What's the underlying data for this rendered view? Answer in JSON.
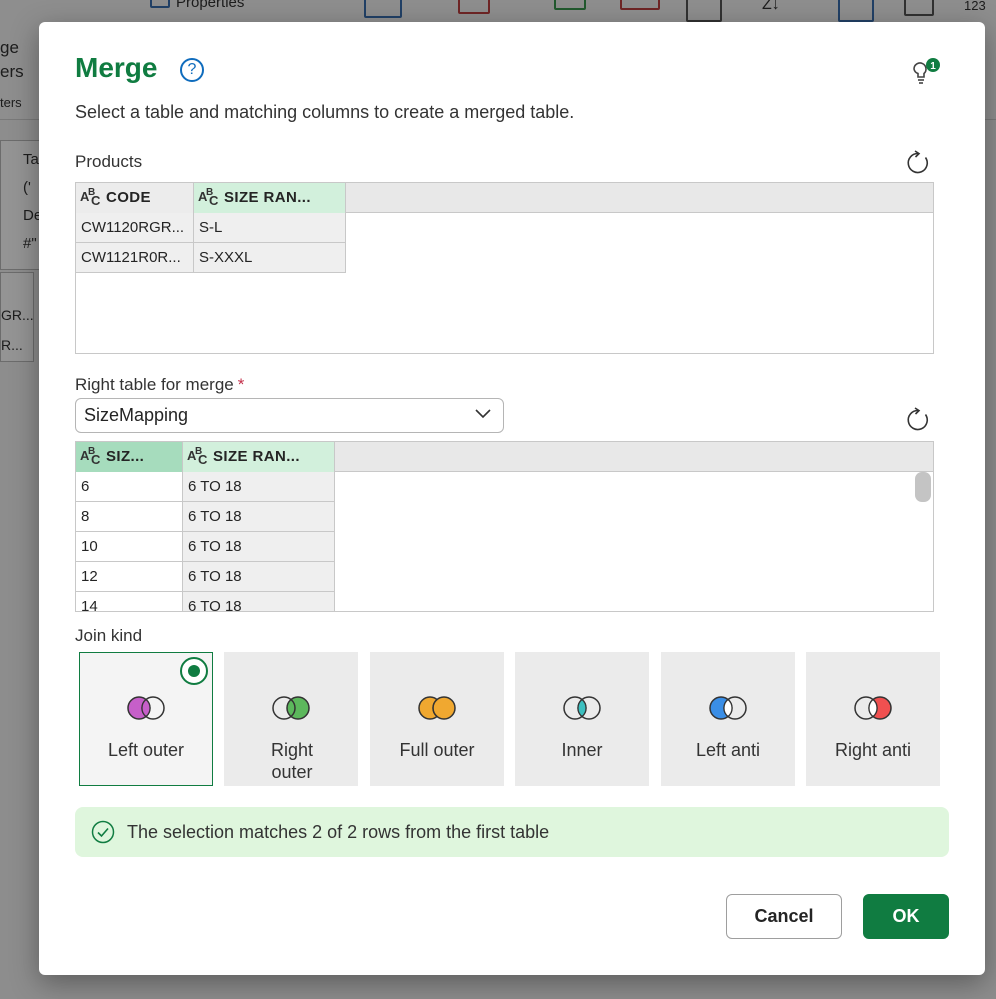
{
  "background": {
    "ribbon_properties": "Properties",
    "ribbon_merge_partial": "ge",
    "ribbon_headers_partial": "ers",
    "ribbon_parameters_partial": "ters",
    "ribbon_sort_partial": "Z↓",
    "ribbon_123": "123",
    "formula_lines": [
      "Ta",
      "('",
      "De",
      "#\""
    ],
    "grid_cells": [
      "GR...",
      "R..."
    ]
  },
  "dialog": {
    "title": "Merge",
    "help_symbol": "?",
    "notification_count": "1",
    "subtitle": "Select a table and matching columns to create a merged table."
  },
  "first_table": {
    "name": "Products",
    "columns": [
      "CODE",
      "SIZE RAN..."
    ],
    "rows": [
      [
        "CW1120RGR...",
        "S-L"
      ],
      [
        "CW1121R0R...",
        "S-XXXL"
      ]
    ]
  },
  "right_table": {
    "label": "Right table for merge",
    "required_mark": "*",
    "selected": "SizeMapping",
    "columns": [
      "SIZ...",
      "SIZE RAN..."
    ],
    "rows": [
      [
        "6",
        "6 TO 18"
      ],
      [
        "8",
        "6 TO 18"
      ],
      [
        "10",
        "6 TO 18"
      ],
      [
        "12",
        "6 TO 18"
      ],
      [
        "14",
        "6 TO 18"
      ]
    ]
  },
  "join_kind": {
    "label": "Join kind",
    "options": [
      {
        "label": "Left outer",
        "selected": true,
        "color": "#c65fc9"
      },
      {
        "label": "Right outer",
        "selected": false,
        "color": "#5cb85c"
      },
      {
        "label": "Full outer",
        "selected": false,
        "color": "#f0a830"
      },
      {
        "label": "Inner",
        "selected": false,
        "color": "#3cc0c0"
      },
      {
        "label": "Left anti",
        "selected": false,
        "color": "#3a8ee6"
      },
      {
        "label": "Right anti",
        "selected": false,
        "color": "#f05050"
      }
    ]
  },
  "status": {
    "message": "The selection matches 2 of 2 rows from the first table",
    "icon": "check-circle-icon"
  },
  "buttons": {
    "cancel": "Cancel",
    "ok": "OK"
  },
  "colors": {
    "accent": "#107c41",
    "help": "#0f6cbd",
    "status_bg": "#dff6dd"
  }
}
